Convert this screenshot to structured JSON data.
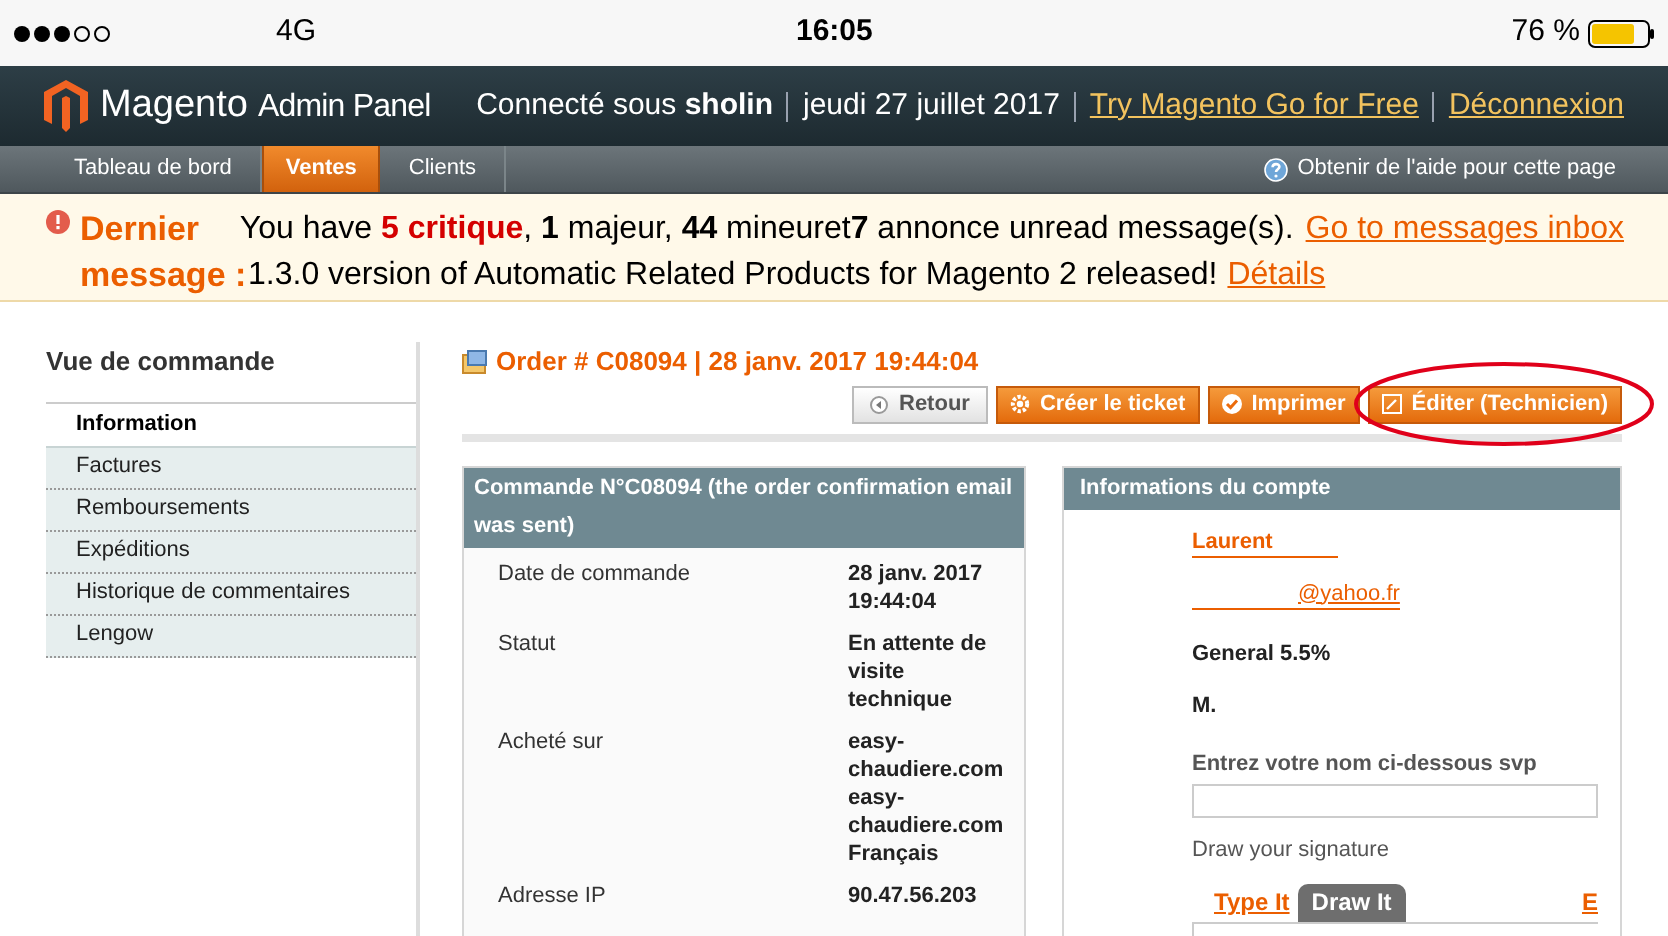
{
  "status_bar": {
    "carrier": "4G",
    "time": "16:05",
    "battery": "76 %"
  },
  "header": {
    "logo": "Magento",
    "logo_sub": "Admin Panel",
    "user": "Connecté sous **sholin**",
    "date": "jeudi 27 juillet 2017",
    "links": [
      "Try Magento Go for Free",
      "Déconnexion"
    ]
  },
  "nav": {
    "tabs": [
      {
        "label": "Tableau de bord",
        "selected": false
      },
      {
        "label": "Ventes",
        "selected": true
      },
      {
        "label": "Clients",
        "selected": false
      }
    ],
    "help": "Obtenir de l'aide pour cette page"
  },
  "notice": {
    "title": "Dernier message :",
    "summary": "You have **5 critique**, **1** majeur, **44** mineuret**7** annonce unread message(s).",
    "summary_link": "Go to messages inbox",
    "message": "1.3.0 version of Automatic Related Products for Magento 2 released!",
    "message_link": "Détails"
  },
  "sidebar": {
    "title": "Vue de commande",
    "items": [
      {
        "label": "Information",
        "selected": true
      },
      {
        "label": "Factures",
        "selected": false
      },
      {
        "label": "Remboursements",
        "selected": false
      },
      {
        "label": "Expéditions",
        "selected": false
      },
      {
        "label": "Historique de commentaires",
        "selected": false
      },
      {
        "label": "Lengow",
        "selected": false
      }
    ]
  },
  "order": {
    "title": "Order # C08094 | 28 janv. 2017 19:44:04",
    "buttons": [
      {
        "label": "Retour",
        "kind": "back",
        "highlighted": false
      },
      {
        "label": "Créer le ticket",
        "kind": "gear",
        "highlighted": false
      },
      {
        "label": "Imprimer",
        "kind": "check",
        "highlighted": false
      },
      {
        "label": "Éditer (Technicien)",
        "kind": "edit",
        "highlighted": true
      }
    ]
  },
  "order_panel": {
    "title": "Commande N°C08094 (the order confirmation email was sent)",
    "rows": [
      {
        "label": "Date de commande",
        "value": [
          "28 janv. 2017",
          "19:44:04"
        ]
      },
      {
        "label": "Statut",
        "value": [
          "En attente de",
          "visite",
          "technique"
        ]
      },
      {
        "label": "Acheté sur",
        "value": [
          "easy-",
          "chaudiere.com",
          "easy-",
          "chaudiere.com",
          "Français"
        ]
      },
      {
        "label": "Adresse IP",
        "value": [
          "90.47.56.203"
        ]
      }
    ]
  },
  "account_panel": {
    "title": "Informations du compte",
    "name": "Laurent",
    "email": "@yahoo.fr",
    "group": "General 5.5%",
    "prefix": "M.",
    "name_prompt": "Entrez votre nom ci-dessous svp",
    "signature_label": "Draw your signature",
    "signature_tabs": [
      {
        "label": "Type It",
        "selected": false
      },
      {
        "label": "Draw It",
        "selected": true
      },
      {
        "label": "E",
        "selected": false
      }
    ]
  }
}
